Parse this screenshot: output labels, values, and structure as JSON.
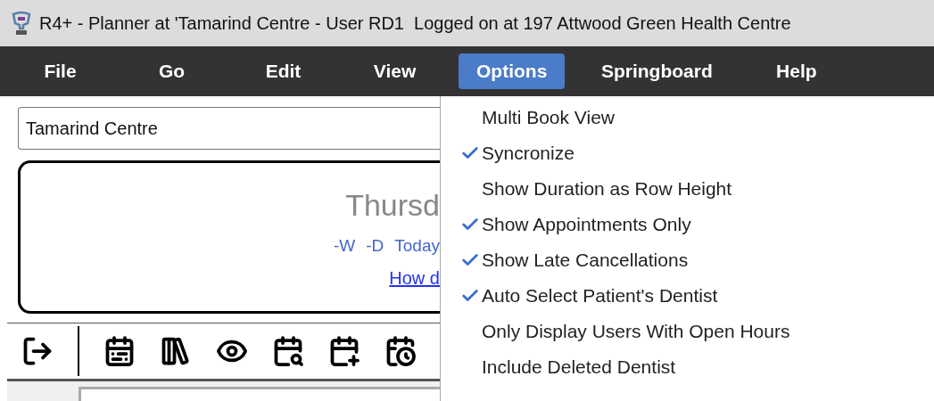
{
  "window": {
    "title": "R4+ - Planner at 'Tamarind Centre - User RD1  Logged on at 197 Attwood Green Health Centre"
  },
  "menus": [
    {
      "label": "File",
      "selected": false
    },
    {
      "label": "Go",
      "selected": false
    },
    {
      "label": "Edit",
      "selected": false
    },
    {
      "label": "View",
      "selected": false
    },
    {
      "label": "Options",
      "selected": true
    },
    {
      "label": "Springboard",
      "selected": false
    },
    {
      "label": "Help",
      "selected": false
    }
  ],
  "location_field": {
    "value": "Tamarind Centre"
  },
  "date_card": {
    "day": "Thursd",
    "nav_links": [
      "-W",
      "-D",
      "Today"
    ],
    "help_link": "How d"
  },
  "options_menu": [
    {
      "label": "Multi Book View",
      "checked": false
    },
    {
      "label": "Syncronize",
      "checked": true
    },
    {
      "label": "Show Duration as Row Height",
      "checked": false
    },
    {
      "label": "Show Appointments Only",
      "checked": true
    },
    {
      "label": "Show Late Cancellations",
      "checked": true
    },
    {
      "label": "Auto Select Patient's Dentist",
      "checked": true
    },
    {
      "label": "Only Display Users With Open Hours",
      "checked": false
    },
    {
      "label": "Include Deleted Dentist",
      "checked": false
    }
  ]
}
